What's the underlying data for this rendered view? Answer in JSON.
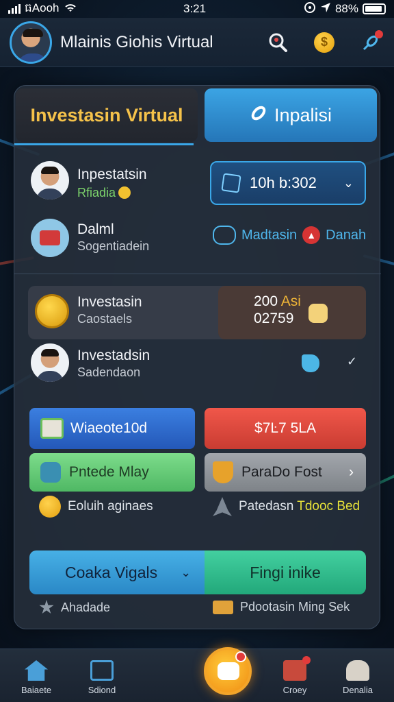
{
  "status_bar": {
    "carrier": "ធAooh",
    "time": "3:21",
    "battery": "88%"
  },
  "header": {
    "title": "Mlainis Giohis Virtual"
  },
  "tabs": [
    {
      "label": "Investasin Virtual",
      "active": true
    },
    {
      "label": "Inpalisi",
      "active": false
    }
  ],
  "rows": {
    "investatsin": {
      "title": "Inpestatsin",
      "subtitle": "Rfiadia"
    },
    "dropdown_value": "10h b:302",
    "dalmi": {
      "title": "Dalml",
      "subtitle": "Sogentiadein"
    },
    "madtasin": {
      "label": "Madtasin",
      "extra": "Danah"
    },
    "investasin_card": {
      "title": "Investasin",
      "subtitle": "Caostaels"
    },
    "price": {
      "line1_a": "200 ",
      "line1_b": "Asi",
      "line2": "02759"
    },
    "investadsin": {
      "title": "Investadsin",
      "subtitle": "Sadendaon"
    }
  },
  "buttons": {
    "blue": "Wiaeote10d",
    "red": "$7Ŀ7 5LA",
    "green": "Pntede Mlay",
    "grey": "ParaDo Fost"
  },
  "line_items": {
    "coin_text": "Eoluih aginaes",
    "rocket_text_a": "Patedasn ",
    "rocket_text_b": "Tdooc Bed"
  },
  "big_buttons": {
    "left": "Coaka Vigals",
    "right": "Fingi inike"
  },
  "footer_items": {
    "left": "Ahadade",
    "right": "Pdootasin Ming Sek"
  },
  "bottom_nav": [
    {
      "label": "Baiaete"
    },
    {
      "label": "Sdiond"
    },
    {
      "label": "Croey"
    },
    {
      "label": "Denalia"
    }
  ],
  "colors": {
    "accent_blue": "#3aa7e8",
    "gold": "#f5c24a",
    "red": "#e23b3b",
    "green": "#4fb864"
  }
}
